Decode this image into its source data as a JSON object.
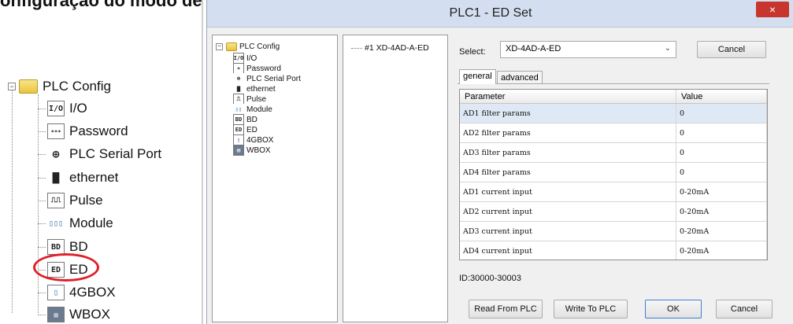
{
  "heading": "onfiguração do modo de trabalho",
  "left_tree": {
    "root": "PLC Config",
    "items": [
      {
        "icon": "I/O",
        "label": "I/O"
      },
      {
        "icon": "pw",
        "label": "Password"
      },
      {
        "icon": "serial",
        "label": "PLC Serial Port"
      },
      {
        "icon": "net",
        "label": "ethernet"
      },
      {
        "icon": "pulse",
        "label": "Pulse"
      },
      {
        "icon": "mod",
        "label": "Module"
      },
      {
        "icon": "BD",
        "label": "BD"
      },
      {
        "icon": "ED",
        "label": "ED"
      },
      {
        "icon": "4G",
        "label": "4GBOX"
      },
      {
        "icon": "WB",
        "label": "WBOX"
      }
    ]
  },
  "dialog": {
    "title": "PLC1 - ED  Set",
    "close": "×",
    "tree": {
      "root": "PLC Config",
      "items": [
        "I/O",
        "Password",
        "PLC Serial Port",
        "ethernet",
        "Pulse",
        "Module",
        "BD",
        "ED",
        "4GBOX",
        "WBOX"
      ]
    },
    "device_item": "#1 XD-4AD-A-ED",
    "select_label": "Select:",
    "select_value": "XD-4AD-A-ED",
    "cancel_top": "Cancel",
    "tabs": [
      "general",
      "advanced"
    ],
    "columns": [
      "Parameter",
      "Value"
    ],
    "rows": [
      [
        "AD1 filter params",
        "0"
      ],
      [
        "AD2 filter params",
        "0"
      ],
      [
        "AD3 filter params",
        "0"
      ],
      [
        "AD4 filter params",
        "0"
      ],
      [
        "AD1 current input",
        "0-20mA"
      ],
      [
        "AD2 current input",
        "0-20mA"
      ],
      [
        "AD3 current input",
        "0-20mA"
      ],
      [
        "AD4 current input",
        "0-20mA"
      ]
    ],
    "id_range": "ID:30000-30003",
    "buttons": {
      "read": "Read From PLC",
      "write": "Write To PLC",
      "ok": "OK",
      "cancel": "Cancel"
    }
  }
}
